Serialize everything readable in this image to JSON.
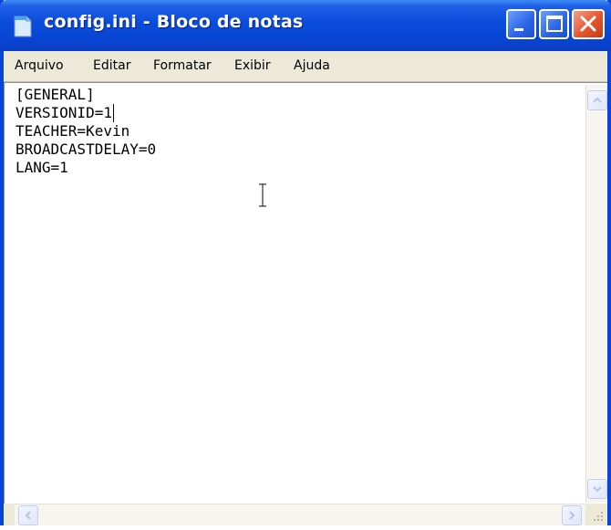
{
  "window": {
    "title": "config.ini - Bloco de notas",
    "colors": {
      "titlebar": "#0a4ddb",
      "frame": "#0846d8",
      "close_button": "#e4552f",
      "menubar": "#ece9d8"
    }
  },
  "title_controls": {
    "minimize_icon": "minimize-icon",
    "maximize_icon": "maximize-icon",
    "close_icon": "close-icon"
  },
  "menu": {
    "items": [
      {
        "label": "Arquivo"
      },
      {
        "label": "Editar"
      },
      {
        "label": "Formatar"
      },
      {
        "label": "Exibir"
      },
      {
        "label": "Ajuda"
      }
    ]
  },
  "editor": {
    "lines": [
      "[GENERAL]",
      "VERSIONID=1",
      "TEACHER=Kevin",
      "BROADCASTDELAY=0",
      "LANG=1"
    ],
    "caret_line": 2,
    "caret_column": 11
  }
}
